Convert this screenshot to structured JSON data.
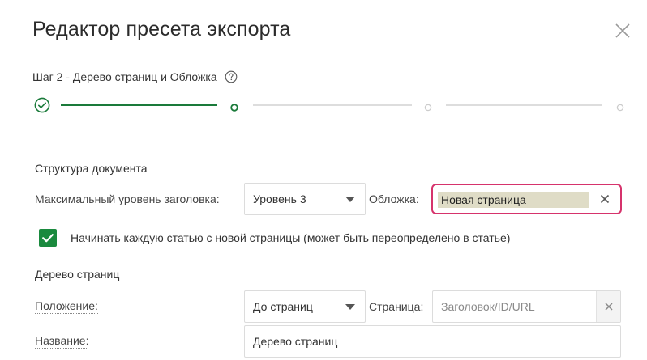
{
  "dialog": {
    "title": "Редактор пресета экспорта"
  },
  "stepper": {
    "label": "Шаг 2 - Дерево страниц и Обложка",
    "steps": [
      {
        "state": "done"
      },
      {
        "state": "current"
      },
      {
        "state": "pending"
      },
      {
        "state": "pending"
      }
    ],
    "colors": {
      "active": "#1a7a3a",
      "inactive": "#dddddd",
      "pending_dot": "#cccccc"
    }
  },
  "document_structure": {
    "section_title": "Структура документа",
    "max_heading_label": "Максимальный уровень заголовка:",
    "max_heading_value": "Уровень 3",
    "cover_label": "Обложка:",
    "cover_value": "Новая страница",
    "new_page_checkbox_label": "Начинать каждую статью с новой страницы (может быть переопределено в статье)",
    "new_page_checked": true
  },
  "page_tree": {
    "section_title": "Дерево страниц",
    "position_label": "Положение:",
    "position_value": "До страниц",
    "page_label": "Страница:",
    "page_placeholder": "Заголовок/ID/URL",
    "name_label": "Название:",
    "name_value": "Дерево страниц"
  },
  "colors": {
    "accent_green": "#1a8a3e",
    "highlight_pink": "#d6336c",
    "chip_bg": "#dfdcc6"
  },
  "icons": {
    "close": "close-icon",
    "help": "help-circle-icon",
    "check": "check-icon",
    "caret": "caret-down-icon",
    "clear": "clear-icon"
  }
}
